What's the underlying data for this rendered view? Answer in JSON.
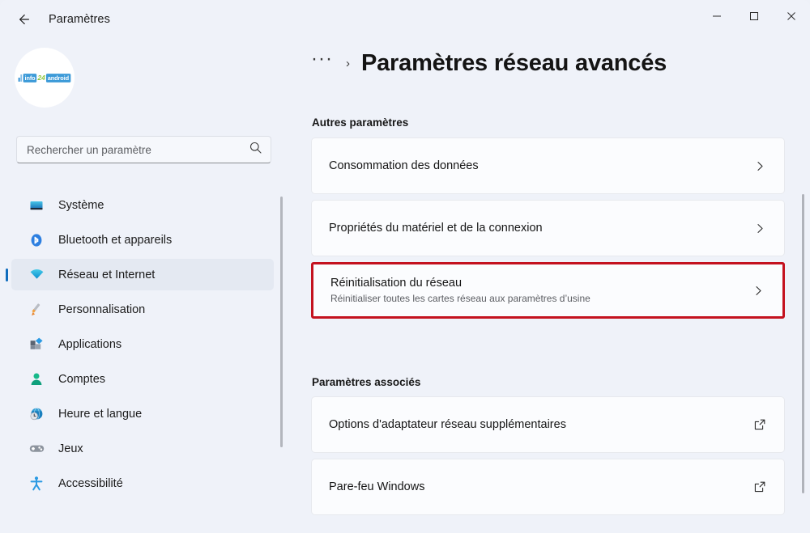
{
  "window": {
    "app_title": "Paramètres",
    "back_icon": "back-arrow-icon",
    "minimize_label": "—",
    "maximize_label": "☐",
    "close_label": "✕"
  },
  "sidebar": {
    "avatar": {
      "logo_text_left": "info",
      "logo_text_mid": "24",
      "logo_text_right": "android"
    },
    "search": {
      "placeholder": "Rechercher un paramètre",
      "value": "",
      "icon": "search-icon"
    },
    "items": [
      {
        "label": "Système",
        "icon": "monitor-icon",
        "selected": false
      },
      {
        "label": "Bluetooth et appareils",
        "icon": "bluetooth-icon",
        "selected": false
      },
      {
        "label": "Réseau et Internet",
        "icon": "wifi-icon",
        "selected": true
      },
      {
        "label": "Personnalisation",
        "icon": "paintbrush-icon",
        "selected": false
      },
      {
        "label": "Applications",
        "icon": "apps-icon",
        "selected": false
      },
      {
        "label": "Comptes",
        "icon": "person-icon",
        "selected": false
      },
      {
        "label": "Heure et langue",
        "icon": "clock-globe-icon",
        "selected": false
      },
      {
        "label": "Jeux",
        "icon": "gamepad-icon",
        "selected": false
      },
      {
        "label": "Accessibilité",
        "icon": "accessibility-icon",
        "selected": false
      }
    ]
  },
  "main": {
    "breadcrumb": {
      "overflow": "···",
      "separator": "›"
    },
    "page_title": "Paramètres réseau avancés",
    "sections": [
      {
        "heading": "Autres paramètres",
        "cards": [
          {
            "title": "Consommation des données",
            "subtitle": "",
            "action_icon": "chevron-right-icon",
            "highlighted": false
          },
          {
            "title": "Propriétés du matériel et de la connexion",
            "subtitle": "",
            "action_icon": "chevron-right-icon",
            "highlighted": false
          },
          {
            "title": "Réinitialisation du réseau",
            "subtitle": "Réinitialiser toutes les cartes réseau aux paramètres d’usine",
            "action_icon": "chevron-right-icon",
            "highlighted": true
          }
        ]
      },
      {
        "heading": "Paramètres associés",
        "cards": [
          {
            "title": "Options d'adaptateur réseau supplémentaires",
            "subtitle": "",
            "action_icon": "external-link-icon",
            "highlighted": false
          },
          {
            "title": "Pare-feu Windows",
            "subtitle": "",
            "action_icon": "external-link-icon",
            "highlighted": false
          }
        ]
      }
    ]
  },
  "colors": {
    "accent": "#0f6cbd",
    "highlight_border": "#c4121f",
    "window_bg": "#eff2f9",
    "card_bg": "#fbfcfe"
  }
}
